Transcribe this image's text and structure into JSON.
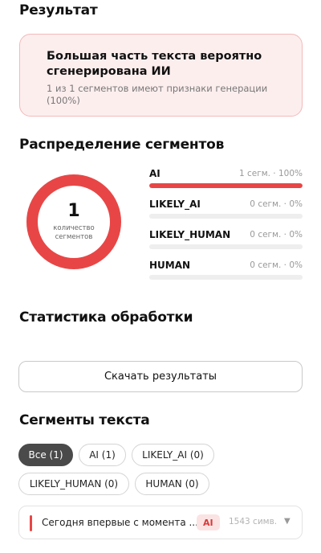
{
  "result": {
    "heading": "Результат",
    "title": "Большая часть текста вероятно сгенерирована ИИ",
    "subtitle": "1 из 1 сегментов имеют признаки генерации (100%)"
  },
  "distribution": {
    "heading": "Распределение сегментов",
    "total": "1",
    "total_label": "количество сегментов",
    "rows": [
      {
        "name": "AI",
        "value": "1 сегм. · 100%",
        "fraction": 1.0,
        "color": "#e84646"
      },
      {
        "name": "LIKELY_AI",
        "value": "0 сегм. · 0%",
        "fraction": 0.0,
        "color": "#f28c8c"
      },
      {
        "name": "LIKELY_HUMAN",
        "value": "0 сегм. · 0%",
        "fraction": 0.0,
        "color": "#8cc98c"
      },
      {
        "name": "HUMAN",
        "value": "0 сегм. · 0%",
        "fraction": 0.0,
        "color": "#4caf50"
      }
    ],
    "donut_color": "#e84646"
  },
  "stats": {
    "heading": "Статистика обработки",
    "download_label": "Скачать результаты"
  },
  "segments": {
    "heading": "Сегменты текста",
    "filters": [
      {
        "label": "Все (1)",
        "active": true
      },
      {
        "label": "AI (1)",
        "active": false
      },
      {
        "label": "LIKELY_AI (0)",
        "active": false
      },
      {
        "label": "LIKELY_HUMAN (0)",
        "active": false
      },
      {
        "label": "HUMAN (0)",
        "active": false
      }
    ],
    "items": [
      {
        "text": "Сегодня впервые с момента ...",
        "label": "AI",
        "length": "1543 симв.",
        "chevron_icon": "chevron-down-icon"
      }
    ]
  }
}
